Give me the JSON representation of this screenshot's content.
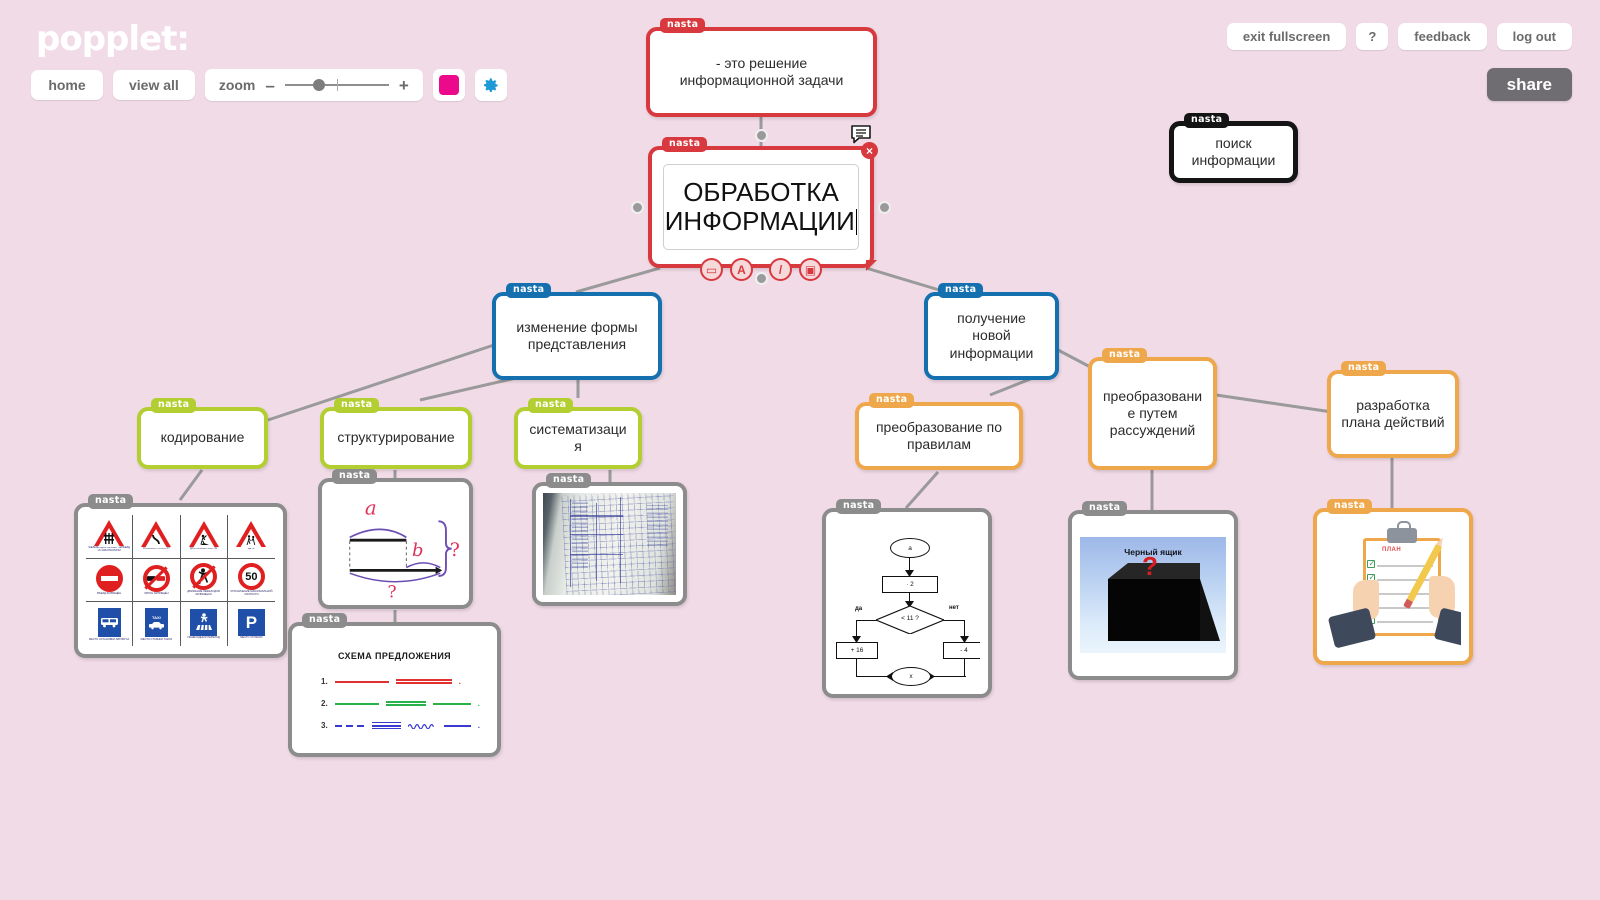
{
  "app": {
    "brand": "popplet:",
    "background_color": "#f1dbe7"
  },
  "toolbar_left": {
    "home_label": "home",
    "view_all_label": "view all",
    "zoom_label": "zoom",
    "zoom_minus": "–",
    "zoom_plus": "+",
    "color_swatch": "#ec0a8c",
    "gear_icon": "gear-icon"
  },
  "toolbar_right": {
    "exit_fullscreen_label": "exit fullscreen",
    "help_label": "?",
    "feedback_label": "feedback",
    "logout_label": "log out",
    "share_label": "share"
  },
  "selected_node": {
    "tag": "nasta",
    "text": "ОБРАБОТКА\nИНФОРМАЦИИ",
    "border_color": "#d8393f",
    "tools": [
      {
        "name": "add-popplet",
        "glyph": "▭"
      },
      {
        "name": "text-tool",
        "glyph": "A"
      },
      {
        "name": "draw-tool",
        "glyph": "/"
      },
      {
        "name": "image-tool",
        "glyph": "▣"
      }
    ],
    "close_label": "×",
    "comment_icon": "comment-icon"
  },
  "nodes": [
    {
      "id": "definition",
      "tag": "nasta",
      "text": "- это решение\nинформационной задачи",
      "color": "#d8393f"
    },
    {
      "id": "poisk",
      "tag": "nasta",
      "text": "поиск\nинформации",
      "color": "#141414"
    },
    {
      "id": "izmenenie",
      "tag": "nasta",
      "text": "изменение формы\nпредставления",
      "color": "#1570b0"
    },
    {
      "id": "poluchenie",
      "tag": "nasta",
      "text": "получение\nновой\nинформации",
      "color": "#1570b0"
    },
    {
      "id": "kodirovanie",
      "tag": "nasta",
      "text": "кодирование",
      "color": "#b2ce30"
    },
    {
      "id": "strukt",
      "tag": "nasta",
      "text": "структурирование",
      "color": "#b2ce30"
    },
    {
      "id": "sistem",
      "tag": "nasta",
      "text": "систематизаци\nя",
      "color": "#b2ce30"
    },
    {
      "id": "pravila",
      "tag": "nasta",
      "text": "преобразование по\nправилам",
      "color": "#efa74c"
    },
    {
      "id": "rassuzhd",
      "tag": "nasta",
      "text": "преобразовани\nе путем\nрассуждений",
      "color": "#efa74c"
    },
    {
      "id": "razrabotka",
      "tag": "nasta",
      "text": "разработка\nплана действий",
      "color": "#efa74c"
    }
  ],
  "media_nodes": [
    {
      "id": "road-signs",
      "tag": "nasta",
      "kind": "road-signs-image",
      "color": "#8c8c8c"
    },
    {
      "id": "math-draw",
      "tag": "nasta",
      "kind": "math-diagram-image",
      "color": "#8c8c8c"
    },
    {
      "id": "sentence",
      "tag": "nasta",
      "kind": "sentence-scheme-image",
      "color": "#8c8c8c"
    },
    {
      "id": "notebook",
      "tag": "nasta",
      "kind": "graph-paper-photo",
      "color": "#8c8c8c"
    },
    {
      "id": "flowchart",
      "tag": "nasta",
      "kind": "flowchart-image",
      "color": "#8c8c8c"
    },
    {
      "id": "blackbox",
      "tag": "nasta",
      "kind": "black-box-image",
      "color": "#8c8c8c"
    },
    {
      "id": "checklist",
      "tag": "nasta",
      "kind": "checklist-image",
      "color": "#efa74c"
    }
  ],
  "road_signs": {
    "captions": [
      "ЖЕЛЕЗНОДОРОЖНЫЙ ПЕРЕЕЗД СО ШЛАГБАУМОМ",
      "ОПАСНЫЙ ПОВОРОТ",
      "ДОРОЖНЫЕ РАБОТЫ",
      "ДЕТИ",
      "ВЪЕЗД ЗАПРЕЩЁН",
      "ОБГОН ЗАПРЕЩЁН",
      "ДВИЖЕНИЕ ПЕШЕХОДОВ ЗАПРЕЩЕНО",
      "ОГРАНИЧЕНИЕ МАКСИМАЛЬНОЙ СКОРОСТИ",
      "МЕСТО ОСТАНОВКИ АВТОБУСА",
      "МЕСТО СТОЯНКИ ТАКСИ",
      "ПЕШЕХОДНЫЙ ПЕРЕХОД",
      "МЕСТО СТОЯНКИ"
    ],
    "speed_limit": "50",
    "parking": "P"
  },
  "sentence_scheme": {
    "title": "СХЕМА ПРЕДЛОЖЕНИЯ",
    "rows": [
      {
        "num": "1.",
        "color": "#e03030"
      },
      {
        "num": "2.",
        "color": "#29b24a"
      },
      {
        "num": "3.",
        "color": "#3a3ad0"
      }
    ]
  },
  "flowchart": {
    "start": "a",
    "op1": "· 2",
    "decision": "< 11 ?",
    "yes_label": "да",
    "no_label": "нет",
    "yes_op": "+ 16",
    "no_op": "- 4",
    "end": "x"
  },
  "black_box": {
    "title": "Черный ящик",
    "question": "?"
  },
  "math_diagram": {
    "a_label": "a",
    "b_label": "b",
    "q1": "?",
    "q2": "?"
  }
}
